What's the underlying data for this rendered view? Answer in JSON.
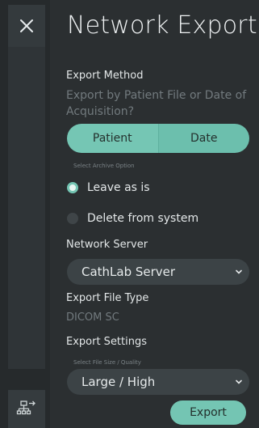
{
  "page": {
    "title": "Network Export"
  },
  "export_method": {
    "label": "Export Method",
    "hint": "Export by Patient File or Date of Acquisition?",
    "options": [
      {
        "label": "Patient",
        "selected": true
      },
      {
        "label": "Date",
        "selected": false
      }
    ]
  },
  "archive": {
    "label": "Select Archive Option",
    "options": [
      {
        "label": "Leave as is",
        "selected": true
      },
      {
        "label": "Delete from system",
        "selected": false
      }
    ]
  },
  "server": {
    "label": "Network Server",
    "value": "CathLab Server"
  },
  "file_type": {
    "label": "Export File Type",
    "value": "DICOM SC"
  },
  "settings": {
    "label": "Export Settings",
    "sublabel": "Select File Size / Quality",
    "value": "Large / High"
  },
  "actions": {
    "export_label": "Export"
  },
  "icons": {
    "close": "close-icon",
    "network": "network-export-icon",
    "chevron": "chevron-down-icon"
  },
  "colors": {
    "accent": "#74c5b3",
    "background": "#2b2f31",
    "rail": "#262a2c",
    "muted_text": "#727a7e"
  }
}
